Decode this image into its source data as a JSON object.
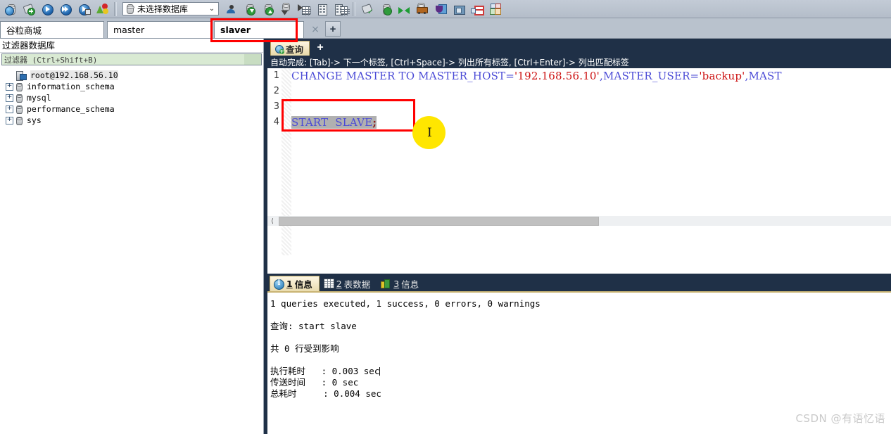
{
  "toolbar": {
    "icons": [
      {
        "name": "open-connection-icon"
      },
      {
        "name": "new-query-icon"
      },
      {
        "name": "run-icon"
      },
      {
        "name": "run-all-icon"
      },
      {
        "name": "run-selection-icon"
      },
      {
        "name": "refresh-object-icon"
      }
    ],
    "database_selector": {
      "value": "未选择数据库",
      "chevron": "⌄"
    },
    "right_icons": [
      {
        "name": "user-manager-icon"
      },
      {
        "name": "backup-download-icon"
      },
      {
        "name": "restore-upload-icon"
      },
      {
        "name": "import-wizard-icon"
      },
      {
        "name": "export-wizard-icon"
      },
      {
        "name": "report-builder-icon"
      },
      {
        "name": "report-viewer-icon"
      },
      {
        "name": "data-transfer-icon"
      },
      {
        "name": "data-synchronization-icon"
      },
      {
        "name": "structure-synchronization-icon"
      },
      {
        "name": "batch-job-icon"
      },
      {
        "name": "schedule-icon"
      },
      {
        "name": "print-icon"
      },
      {
        "name": "query-builder-icon"
      },
      {
        "name": "model-icon"
      }
    ]
  },
  "connection_tabs": {
    "items": [
      {
        "label": "谷粒商城",
        "active": false
      },
      {
        "label": "master",
        "active": false
      },
      {
        "label": "slaver",
        "active": true
      }
    ],
    "close_label": "×",
    "add_label": "+"
  },
  "sidebar": {
    "title": "过滤器数据库",
    "filter": {
      "placeholder": "过滤器 (Ctrl+Shift+B)",
      "value": "过滤器 (Ctrl+Shift+B)"
    },
    "tree": [
      {
        "label": "root@192.168.56.10",
        "type": "server",
        "expandable": false,
        "selected": true
      },
      {
        "label": "information_schema",
        "type": "database",
        "expandable": true,
        "selected": false
      },
      {
        "label": "mysql",
        "type": "database",
        "expandable": true,
        "selected": false
      },
      {
        "label": "performance_schema",
        "type": "database",
        "expandable": true,
        "selected": false
      },
      {
        "label": "sys",
        "type": "database",
        "expandable": true,
        "selected": false
      }
    ],
    "expand_glyph": "+"
  },
  "editor": {
    "tab_label": "查询",
    "add_tab_label": "+",
    "hint": "自动完成: [Tab]-> 下一个标签, [Ctrl+Space]-> 列出所有标签, [Ctrl+Enter]-> 列出匹配标签",
    "line_numbers": [
      "1",
      "2",
      "3",
      "4"
    ],
    "lines": [
      {
        "n": 1,
        "segments": [
          {
            "text": "CHANGE MASTER TO MASTER_HOST=",
            "cls": "kw"
          },
          {
            "text": "'192.168.56.10'",
            "cls": "str"
          },
          {
            "text": ",MASTER_USER=",
            "cls": "kw"
          },
          {
            "text": "'backup'",
            "cls": "str"
          },
          {
            "text": ",MAST",
            "cls": "kw"
          }
        ]
      },
      {
        "n": 2,
        "segments": []
      },
      {
        "n": 3,
        "segments": []
      },
      {
        "n": 4,
        "selected": true,
        "segments": [
          {
            "text": "START  SLAVE",
            "cls": "kw"
          },
          {
            "text": ";",
            "cls": "semi"
          }
        ]
      }
    ]
  },
  "result": {
    "tabs": [
      {
        "num": "1",
        "label": "信息",
        "icon": "info-icon",
        "active": true
      },
      {
        "num": "2",
        "label": "表数据",
        "icon": "table-icon",
        "active": false
      },
      {
        "num": "3",
        "label": "信息",
        "icon": "profile-icon",
        "active": false
      }
    ],
    "log": [
      "1 queries executed, 1 success, 0 errors, 0 warnings",
      "",
      "查询: start slave",
      "",
      "共 0 行受到影响",
      "",
      "执行耗时   : 0.003 sec",
      "传送时间   : 0 sec",
      "总耗时     : 0.004 sec"
    ]
  },
  "annotations": {
    "highlight_boxes": [
      "slaver-tab",
      "start-slave-statement"
    ],
    "cursor_marker": "text-caret"
  },
  "watermark": "CSDN @有语忆语",
  "colors": {
    "accent_dark": "#1f3047",
    "annotation_red": "#ff0000",
    "cursor_yellow": "#ffe600",
    "keyword_blue": "#4b4bd6",
    "string_red": "#cc1111",
    "tab_gold": "#e8d9a8"
  }
}
